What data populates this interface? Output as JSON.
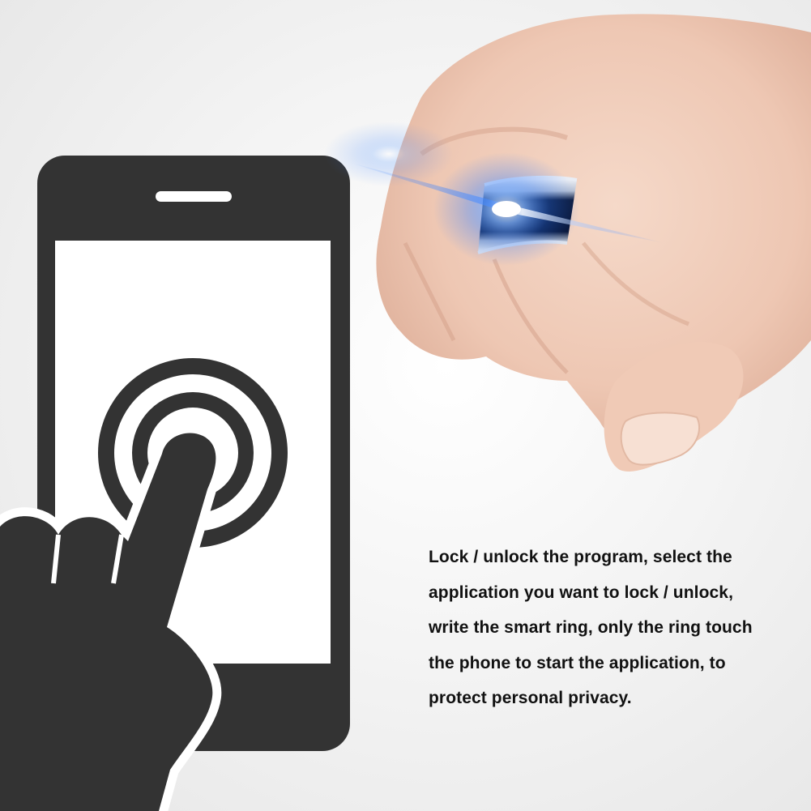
{
  "caption": {
    "lines": [
      "Lock / unlock the program, select the",
      "application you want to lock / unlock,",
      "write the smart ring, only the ring touch",
      "the phone to start the application, to",
      "protect personal privacy."
    ]
  },
  "colors": {
    "icon_fill": "#333333",
    "ring_glow": "#2f7bff",
    "skin": "#f0cdbb",
    "text": "#111111"
  },
  "icons": {
    "phone": "smartphone-icon",
    "touch": "tap-finger-icon",
    "ring": "smart-ring-icon"
  }
}
